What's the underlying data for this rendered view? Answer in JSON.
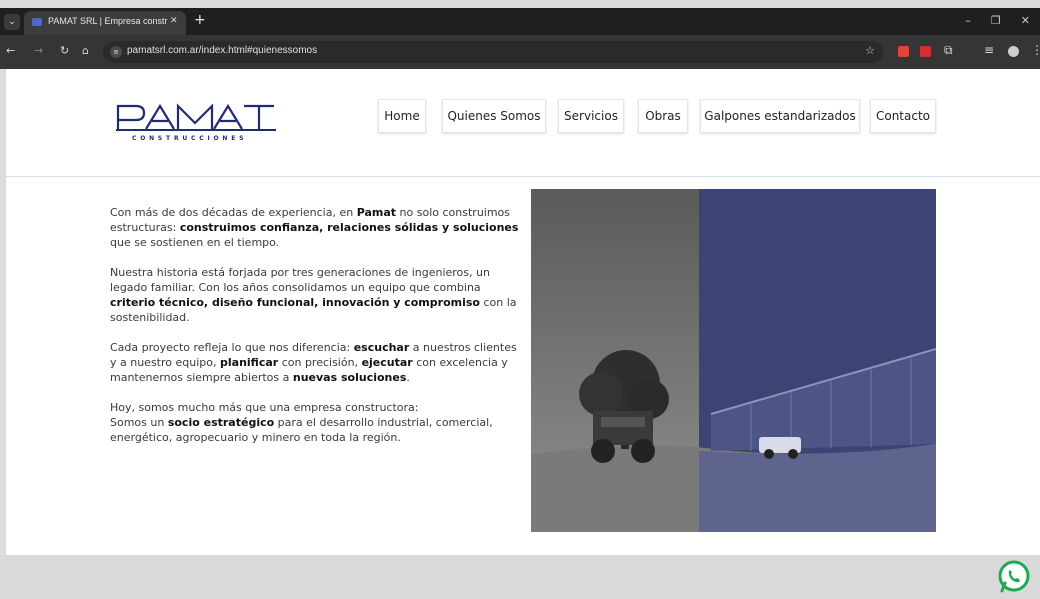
{
  "browser": {
    "tab_title": "PAMAT SRL | Empresa construc",
    "url": "pamatsrl.com.ar/index.html#quienessomos"
  },
  "nav": {
    "items": [
      {
        "label": "Home"
      },
      {
        "label": "Quienes Somos"
      },
      {
        "label": "Servicios"
      },
      {
        "label": "Obras"
      },
      {
        "label": "Galpones estandarizados"
      },
      {
        "label": "Contacto"
      }
    ]
  },
  "logo": {
    "main": "PAMAT",
    "sub": "CONSTRUCCIONES"
  },
  "about": {
    "p1": {
      "a": "Con más de dos décadas de experiencia, en ",
      "b1": "Pamat",
      "c": " no solo construimos estructuras: ",
      "b2": "construimos confianza, relaciones sólidas y soluciones",
      "d": " que se sostienen en el tiempo."
    },
    "p2": {
      "a": "Nuestra historia está forjada por tres generaciones de ingenieros, un legado familiar. Con los años consolidamos un equipo que combina ",
      "b1": "criterio técnico, diseño funcional, innovación y compromiso",
      "c": " con la sostenibilidad."
    },
    "p3": {
      "a": "Cada proyecto refleja lo que nos diferencia: ",
      "b1": "escuchar",
      "c": " a nuestros clientes y a nuestro equipo, ",
      "b2": "planificar",
      "d": " con precisión, ",
      "b3": "ejecutar",
      "e": " con excelencia y mantenernos siempre abiertos a ",
      "b4": "nuevas soluciones",
      "f": "."
    },
    "p4": {
      "a": "Hoy, somos mucho más que una empresa constructora:",
      "b": "Somos un ",
      "b1": "socio estratégico",
      "c": " para el desarrollo industrial, comercial, energético, agropecuario y minero en toda la región."
    }
  },
  "colors": {
    "brand_navy": "#1f2c73",
    "photo_tint": "#3b4373"
  }
}
